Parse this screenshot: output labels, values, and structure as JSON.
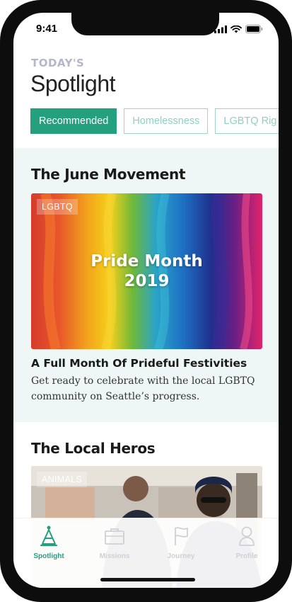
{
  "status": {
    "time": "9:41"
  },
  "header": {
    "eyebrow": "TODAY'S",
    "title": "Spotlight"
  },
  "chips": [
    {
      "label": "Recommended",
      "active": true
    },
    {
      "label": "Homelessness",
      "active": false
    },
    {
      "label": "LGBTQ Rig",
      "active": false
    }
  ],
  "section1": {
    "title": "The June Movement",
    "card": {
      "tag": "LGBTQ",
      "image_text_line1": "Pride Month",
      "image_text_line2": "2019",
      "title": "A Full Month Of Prideful Festivities",
      "description": "Get ready to celebrate with the local LGBTQ community on Seattle’s progress."
    }
  },
  "section2": {
    "title": "The Local Heros",
    "card": {
      "tag": "ANIMALS"
    }
  },
  "tabbar": {
    "tabs": [
      {
        "label": "Spotlight",
        "icon": "spotlight-icon",
        "active": true
      },
      {
        "label": "Missions",
        "icon": "briefcase-icon",
        "active": false
      },
      {
        "label": "Journey",
        "icon": "flag-icon",
        "active": false
      },
      {
        "label": "Profile",
        "icon": "person-icon",
        "active": false
      }
    ]
  },
  "colors": {
    "accent": "#24a07f",
    "chip_border": "#9ed7c9",
    "section_bg": "#eef7f5",
    "eyebrow": "#b4b7c9"
  }
}
